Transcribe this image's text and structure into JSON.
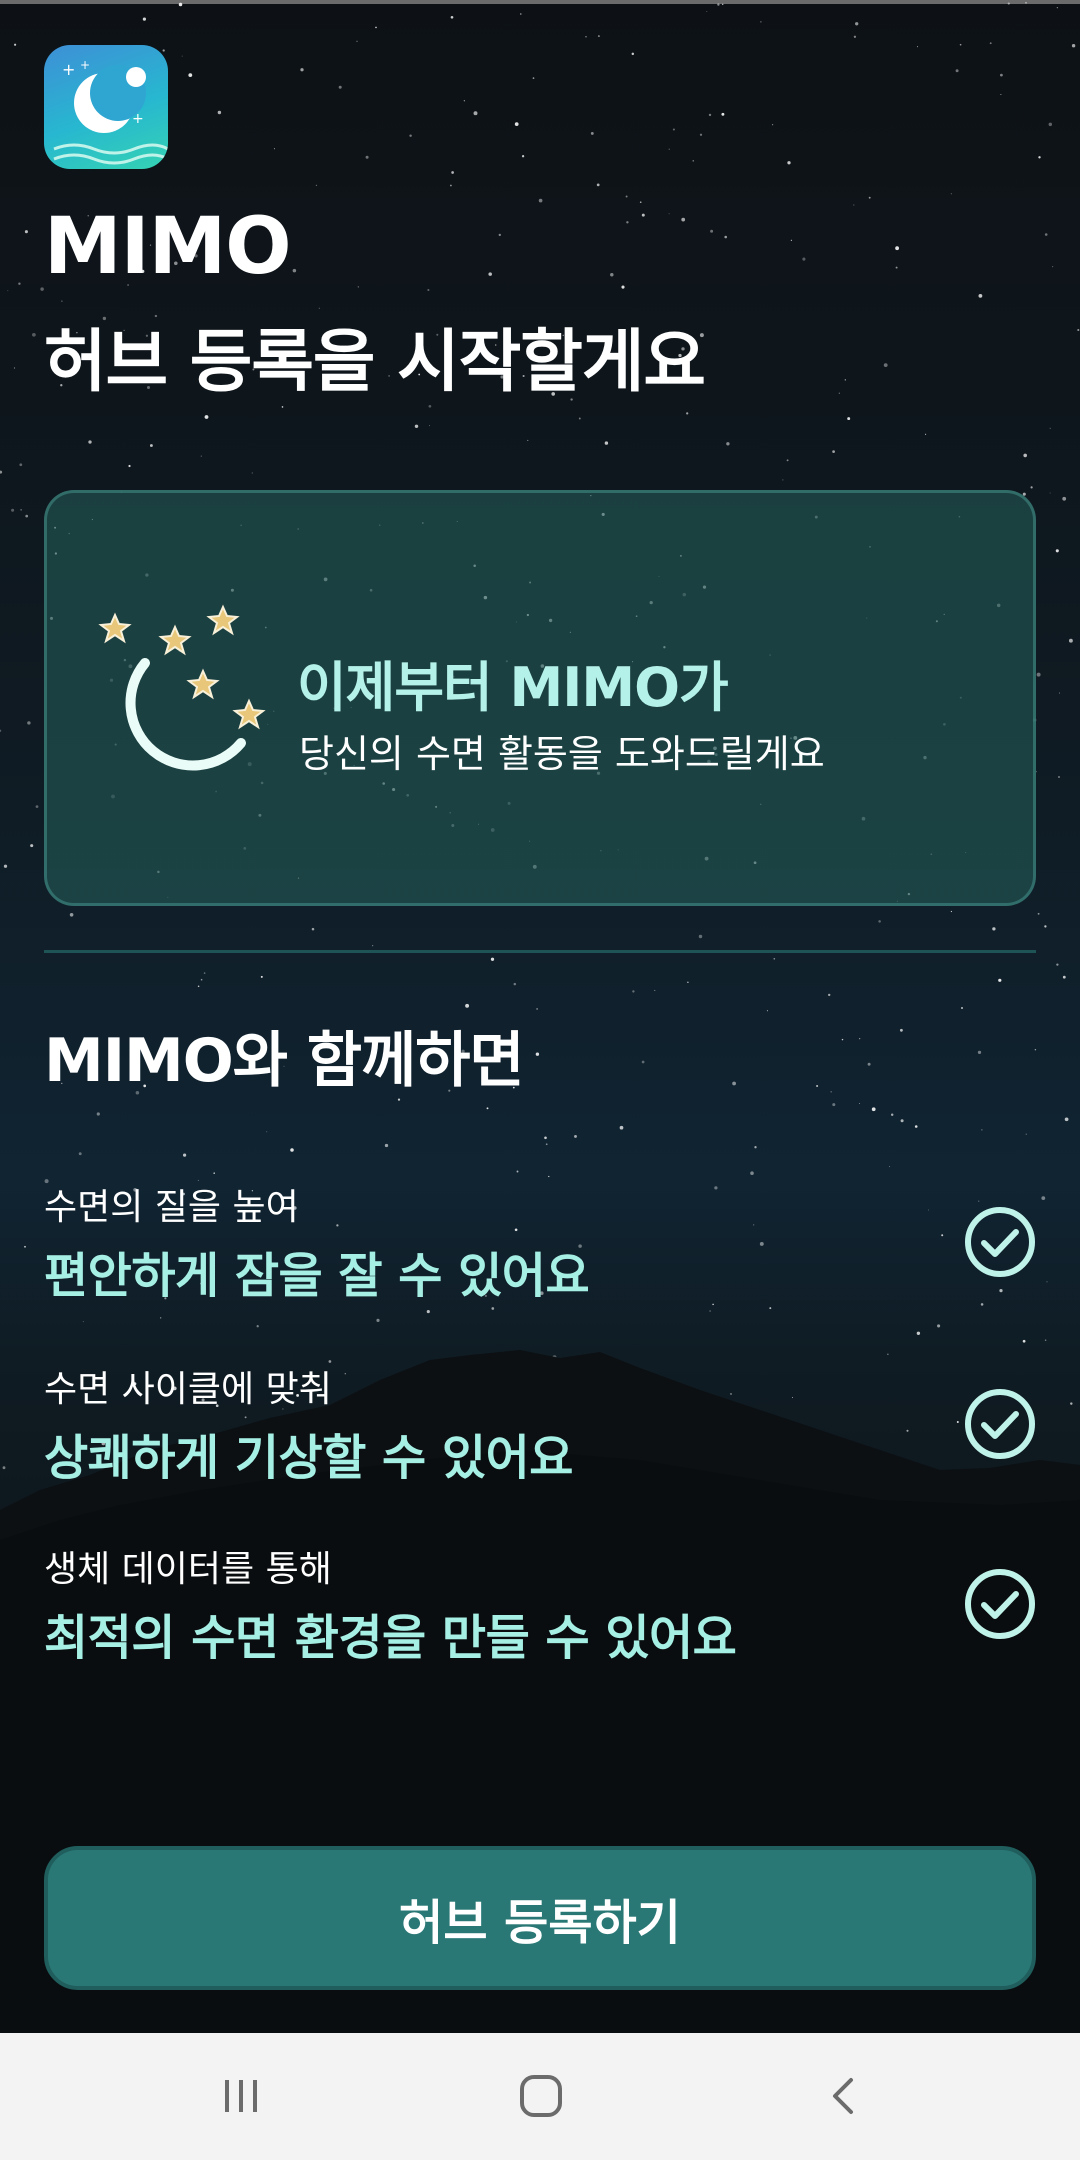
{
  "app": {
    "name": "MIMO",
    "headline": "허브 등록을 시작할게요"
  },
  "promo": {
    "title": "이제부터 MIMO가",
    "subtitle": "당신의 수면 활동을 도와드릴게요"
  },
  "benefits": {
    "title": "MIMO와 함께하면",
    "items": [
      {
        "caption": "수면의 질을 높여",
        "text": "편안하게 잠을 잘 수 있어요",
        "icon": "check-circle-icon"
      },
      {
        "caption": "수면 사이클에 맞춰",
        "text": "상쾌하게 기상할 수 있어요",
        "icon": "check-circle-icon"
      },
      {
        "caption": "생체 데이터를 통해",
        "text": "최적의 수면 환경을 만들 수 있어요",
        "icon": "check-circle-icon"
      }
    ]
  },
  "cta": {
    "label": "허브 등록하기"
  },
  "navbar": {
    "recents_icon": "recent-apps-icon",
    "home_icon": "home-icon",
    "back_icon": "back-icon"
  },
  "colors": {
    "accent": "#a6efe4",
    "card_bg": "#235856",
    "button_bg": "#2a7876"
  }
}
